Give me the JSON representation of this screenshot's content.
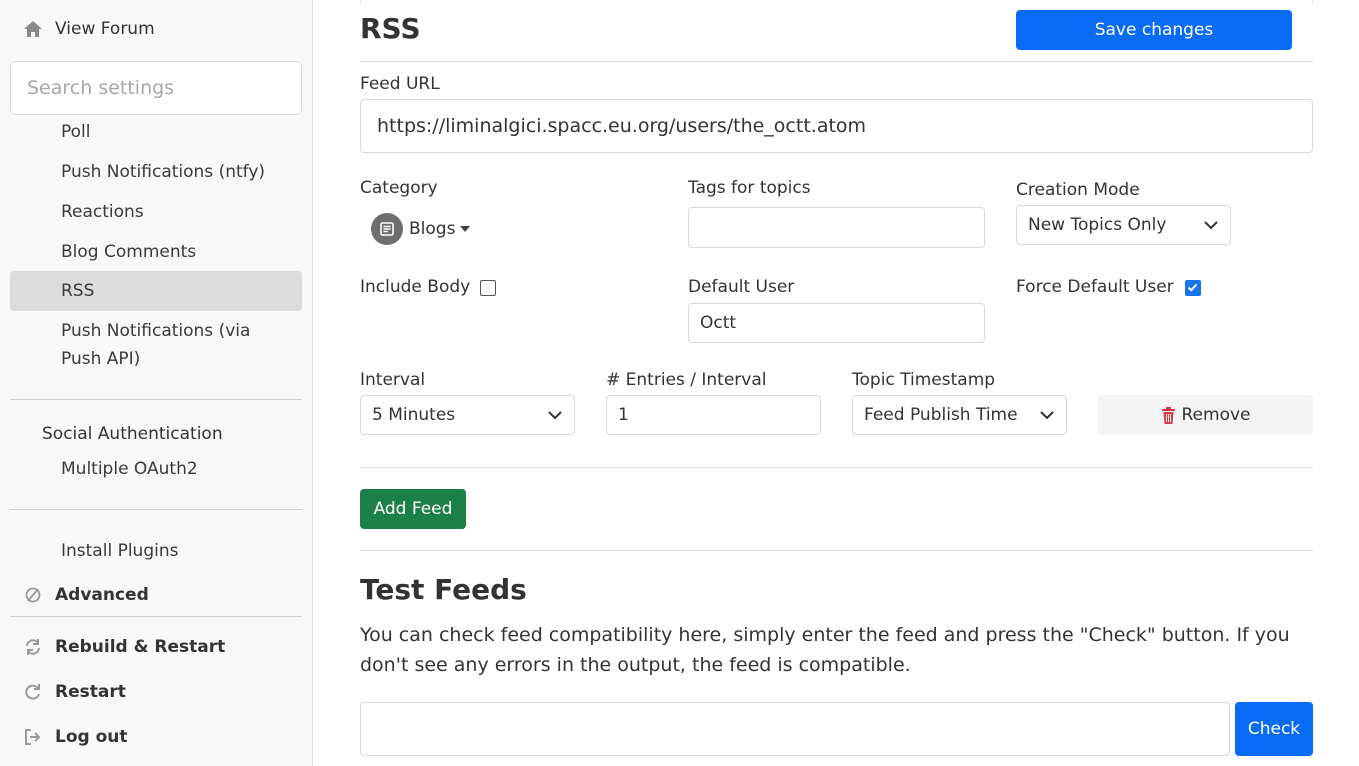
{
  "sidebar": {
    "view_forum": "View Forum",
    "search_placeholder": "Search settings",
    "items": {
      "poll": "Poll",
      "push_ntfy": "Push Notifications (ntfy)",
      "reactions": "Reactions",
      "blog_comments": "Blog Comments",
      "rss": "RSS",
      "push_api_line1": "Push Notifications (via",
      "push_api_line2": "Push API)"
    },
    "social_auth_heading": "Social Authentication",
    "multiple_oauth2": "Multiple OAuth2",
    "install_plugins": "Install Plugins",
    "advanced": "Advanced",
    "rebuild_restart": "Rebuild & Restart",
    "restart": "Restart",
    "log_out": "Log out",
    "icons": [
      "home-icon",
      "advanced-icon",
      "rebuild-icon",
      "restart-icon",
      "logout-icon"
    ]
  },
  "main": {
    "title": "RSS",
    "save_label": "Save changes",
    "feed_url_label": "Feed URL",
    "feed_url_value": "https://liminalgici.spacc.eu.org/users/the_octt.atom",
    "category_label": "Category",
    "category_value": "Blogs",
    "tags_label": "Tags for topics",
    "tags_value": "",
    "creation_mode_label": "Creation Mode",
    "creation_mode_value": "New Topics Only",
    "include_body_label": "Include Body",
    "include_body_checked": false,
    "default_user_label": "Default User",
    "default_user_value": "Octt",
    "force_default_user_label": "Force Default User",
    "force_default_user_checked": true,
    "interval_label": "Interval",
    "interval_value": "5 Minutes",
    "entries_label": "# Entries / Interval",
    "entries_value": "1",
    "topic_timestamp_label": "Topic Timestamp",
    "topic_timestamp_value": "Feed Publish Time",
    "remove_label": "Remove",
    "add_feed_label": "Add Feed",
    "test_title": "Test Feeds",
    "test_description": "You can check feed compatibility here, simply enter the feed and press the \"Check\" button. If you don't see any errors in the output, the feed is compatible.",
    "test_input_value": "",
    "check_label": "Check"
  },
  "colors": {
    "primary": "#0a6cf5",
    "success": "#1d8048",
    "danger": "#dc3545",
    "sidebar_bg": "#f8f8f8",
    "active_bg": "#dcdcdc"
  }
}
